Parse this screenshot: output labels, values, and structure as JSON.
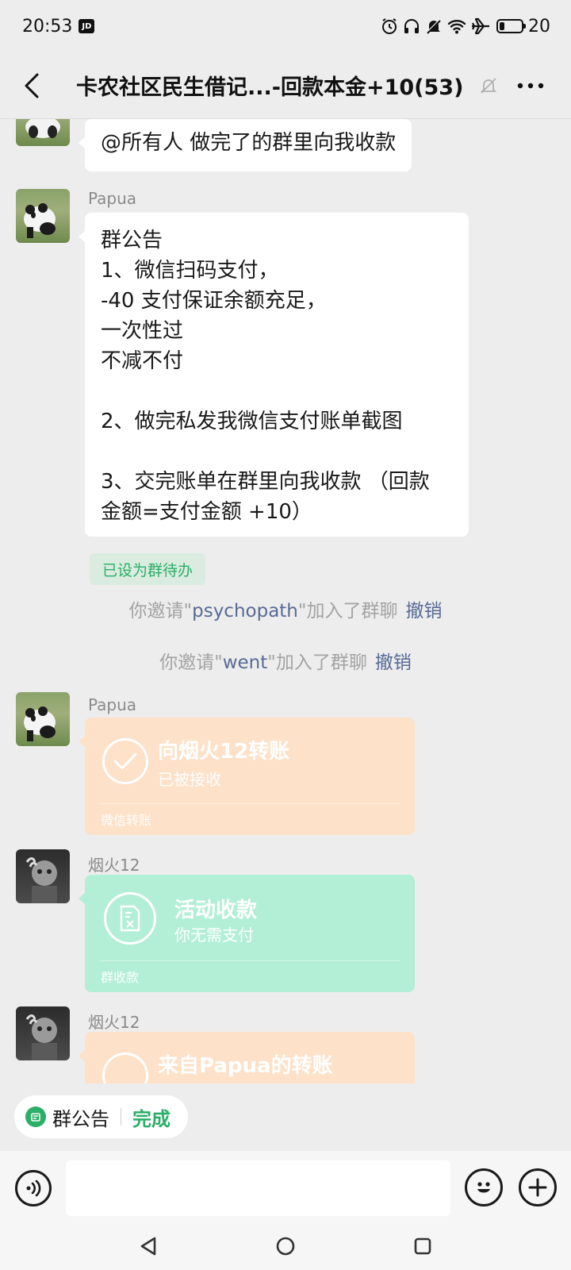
{
  "status_bar": {
    "time": "20:53",
    "app_badge": "JD",
    "battery_level": "20"
  },
  "header": {
    "title": "卡农社区民生借记...-回款本金+10(53)",
    "icons": [
      "back-arrow-icon",
      "mute-bell-icon",
      "more-icon"
    ]
  },
  "messages": {
    "top_bubble": "@所有人 做完了的群里向我收款",
    "announcement": {
      "sender": "Papua",
      "lines": [
        "群公告",
        "1、微信扫码支付，",
        "-40 支付保证余额充足，",
        "一次性过",
        "不减不付",
        "",
        "2、做完私发我微信支付账单截图",
        "",
        "3、交完账单在群里向我收款 （回款",
        "金额=支付金额 +10）"
      ],
      "todo_tag": "已设为群待办"
    },
    "system": [
      {
        "prefix": "你邀请\"",
        "name": "psychopath",
        "suffix": "\"加入了群聊",
        "action": "撤销"
      },
      {
        "prefix": "你邀请\"",
        "name": "went",
        "suffix": "\"加入了群聊",
        "action": "撤销"
      }
    ],
    "transfer": {
      "sender": "Papua",
      "title": "向烟火12转账",
      "status": "已被接收",
      "footer": "微信转账"
    },
    "collection": {
      "sender": "烟火12",
      "title": "活动收款",
      "status": "你无需支付",
      "footer": "群收款"
    },
    "partial": {
      "sender": "烟火12",
      "title": "来自Papua的转账"
    }
  },
  "notice_bar": {
    "label": "群公告",
    "done": "完成"
  },
  "input": {
    "placeholder": ""
  },
  "colors": {
    "wechat_green": "#2bae67",
    "link_blue": "#576b95",
    "transfer_orange": "#fde1c8",
    "collect_green": "#b2efd6"
  }
}
